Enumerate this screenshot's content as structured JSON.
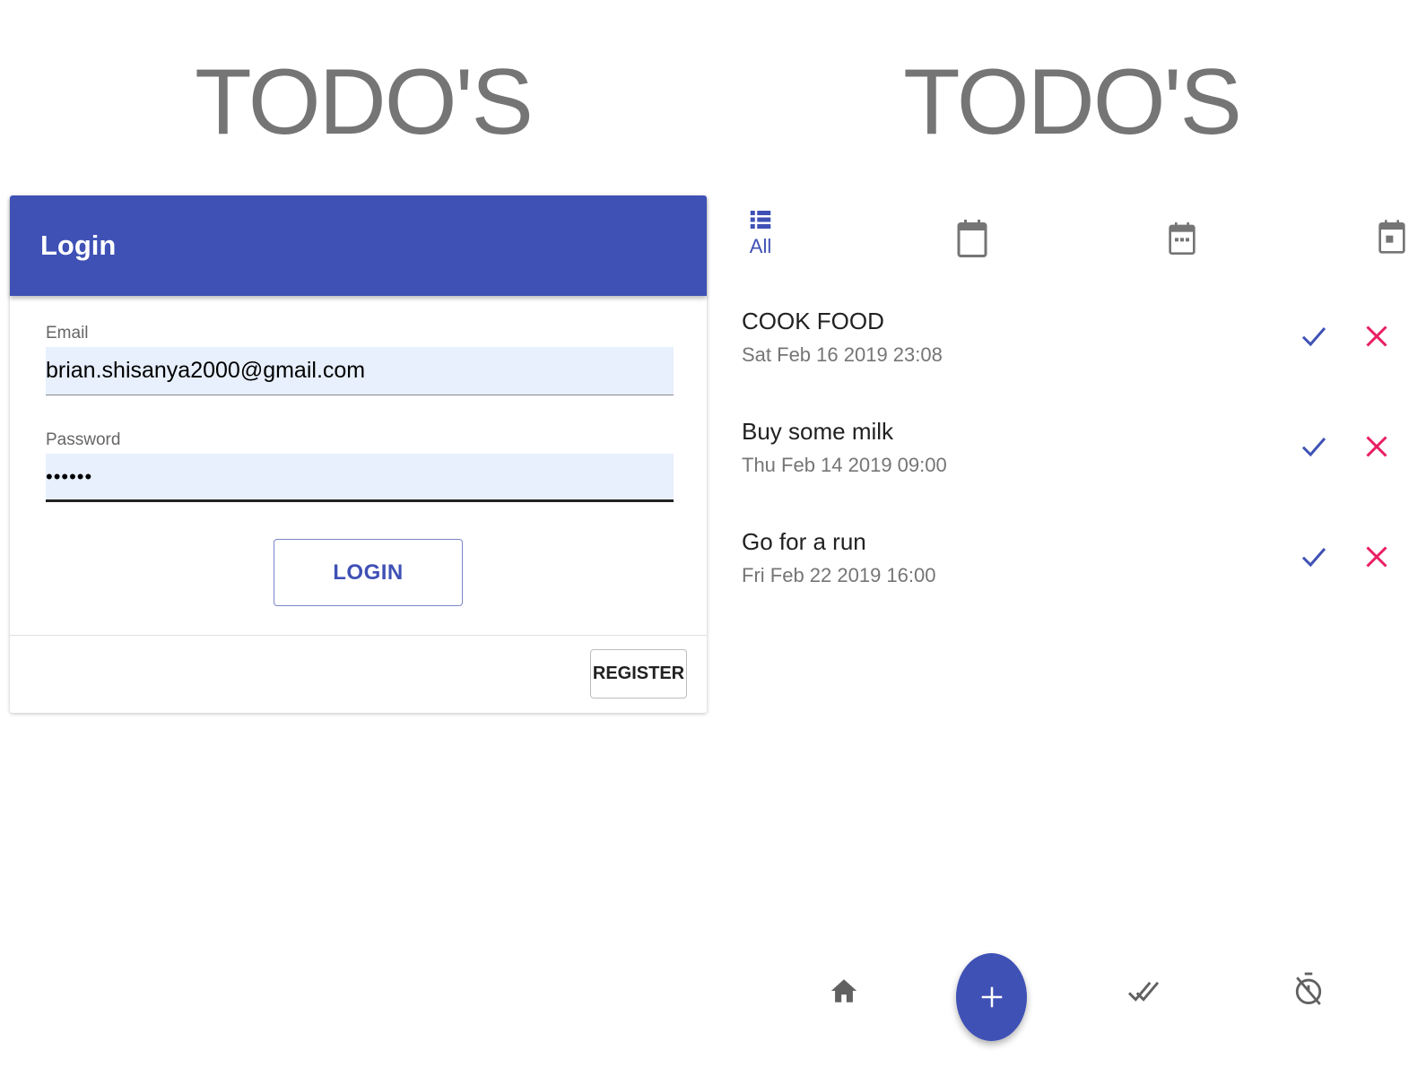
{
  "left_panel": {
    "app_title": "TODO'S",
    "card": {
      "header_title": "Login",
      "email": {
        "label": "Email",
        "value": "brian.shisanya2000@gmail.com"
      },
      "password": {
        "label": "Password",
        "value": "••••••"
      },
      "login_label": "LOGIN",
      "register_label": "REGISTER"
    }
  },
  "right_panel": {
    "app_title": "TODO'S",
    "tabs": [
      {
        "icon": "list-icon",
        "label": "All",
        "active": true
      },
      {
        "icon": "calendar-blank-icon",
        "label": ""
      },
      {
        "icon": "calendar-week-icon",
        "label": ""
      },
      {
        "icon": "calendar-day-icon",
        "label": ""
      }
    ],
    "todos": [
      {
        "title": "COOK FOOD",
        "date": "Sat Feb 16 2019 23:08"
      },
      {
        "title": "Buy some milk",
        "date": "Thu Feb 14 2019 09:00"
      },
      {
        "title": "Go for a run",
        "date": "Fri Feb 22 2019 16:00"
      }
    ],
    "bottom_nav": [
      {
        "icon": "home-icon"
      },
      {
        "icon": "add-icon"
      },
      {
        "icon": "done-all-icon"
      },
      {
        "icon": "timer-off-icon"
      }
    ]
  },
  "colors": {
    "primary": "#3F51B5",
    "delete": "#E91E63",
    "input_background": "#E8F0FE",
    "title_gray": "#757575"
  }
}
